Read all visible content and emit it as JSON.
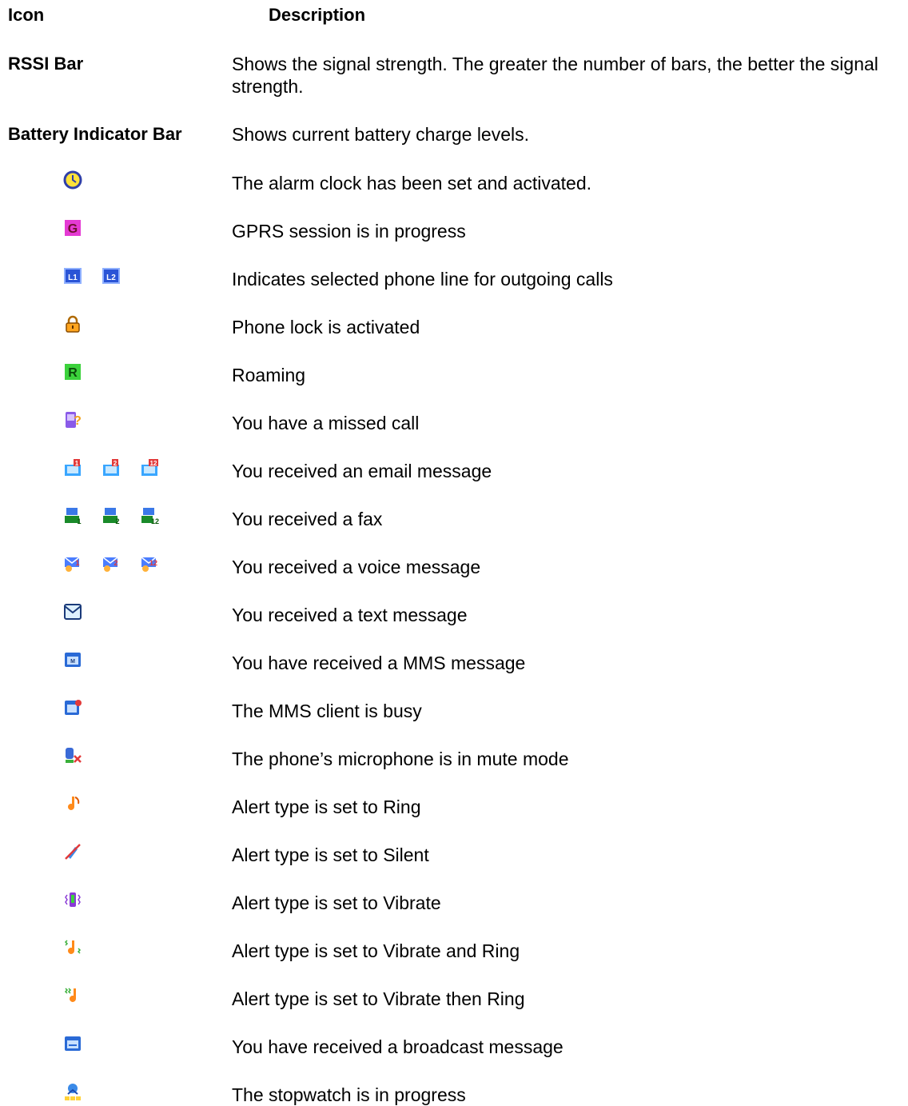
{
  "header": {
    "icon_col": "Icon",
    "desc_col": "Description"
  },
  "rows": [
    {
      "name": "RSSI Bar",
      "icons": [],
      "desc": "Shows the signal strength. The greater the number of bars, the better the signal strength."
    },
    {
      "name": "Battery Indicator Bar",
      "icons": [],
      "desc": "Shows current battery charge levels."
    },
    {
      "name": "",
      "icons": [
        "alarm-clock-icon"
      ],
      "desc": "The alarm clock has been set and activated."
    },
    {
      "name": "",
      "icons": [
        "gprs-icon"
      ],
      "desc": "GPRS session is in progress"
    },
    {
      "name": "",
      "icons": [
        "line1-icon",
        "line2-icon"
      ],
      "desc": "Indicates selected phone line for outgoing calls"
    },
    {
      "name": "",
      "icons": [
        "phone-lock-icon"
      ],
      "desc": "Phone lock is activated"
    },
    {
      "name": "",
      "icons": [
        "roaming-icon"
      ],
      "desc": "Roaming"
    },
    {
      "name": "",
      "icons": [
        "missed-call-icon"
      ],
      "desc": "You have a missed call"
    },
    {
      "name": "",
      "icons": [
        "email-1-icon",
        "email-2-icon",
        "email-12-icon"
      ],
      "desc": "You received an email message"
    },
    {
      "name": "",
      "icons": [
        "fax-1-icon",
        "fax-2-icon",
        "fax-12-icon"
      ],
      "desc": "You received a fax"
    },
    {
      "name": "",
      "icons": [
        "voice-1-icon",
        "voice-2-icon",
        "voice-12-icon"
      ],
      "desc": "You received a voice message"
    },
    {
      "name": "",
      "icons": [
        "text-message-icon"
      ],
      "desc": "You received a text message"
    },
    {
      "name": "",
      "icons": [
        "mms-message-icon"
      ],
      "desc": "You have received a MMS message"
    },
    {
      "name": "",
      "icons": [
        "mms-busy-icon"
      ],
      "desc": "The MMS client is busy"
    },
    {
      "name": "",
      "icons": [
        "mic-mute-icon"
      ],
      "desc": "The phone’s microphone is in mute mode"
    },
    {
      "name": "",
      "icons": [
        "ring-icon"
      ],
      "desc": "Alert type is set to Ring"
    },
    {
      "name": "",
      "icons": [
        "silent-icon"
      ],
      "desc": "Alert type is set to Silent"
    },
    {
      "name": "",
      "icons": [
        "vibrate-icon"
      ],
      "desc": "Alert type is set to Vibrate"
    },
    {
      "name": "",
      "icons": [
        "vibrate-and-ring-icon"
      ],
      "desc": "Alert type is set to Vibrate and Ring"
    },
    {
      "name": "",
      "icons": [
        "vibrate-then-ring-icon"
      ],
      "desc": "Alert type is set to Vibrate then Ring"
    },
    {
      "name": "",
      "icons": [
        "broadcast-message-icon"
      ],
      "desc": "You have received a broadcast message"
    },
    {
      "name": "",
      "icons": [
        "stopwatch-icon"
      ],
      "desc": "The stopwatch is in progress"
    }
  ]
}
